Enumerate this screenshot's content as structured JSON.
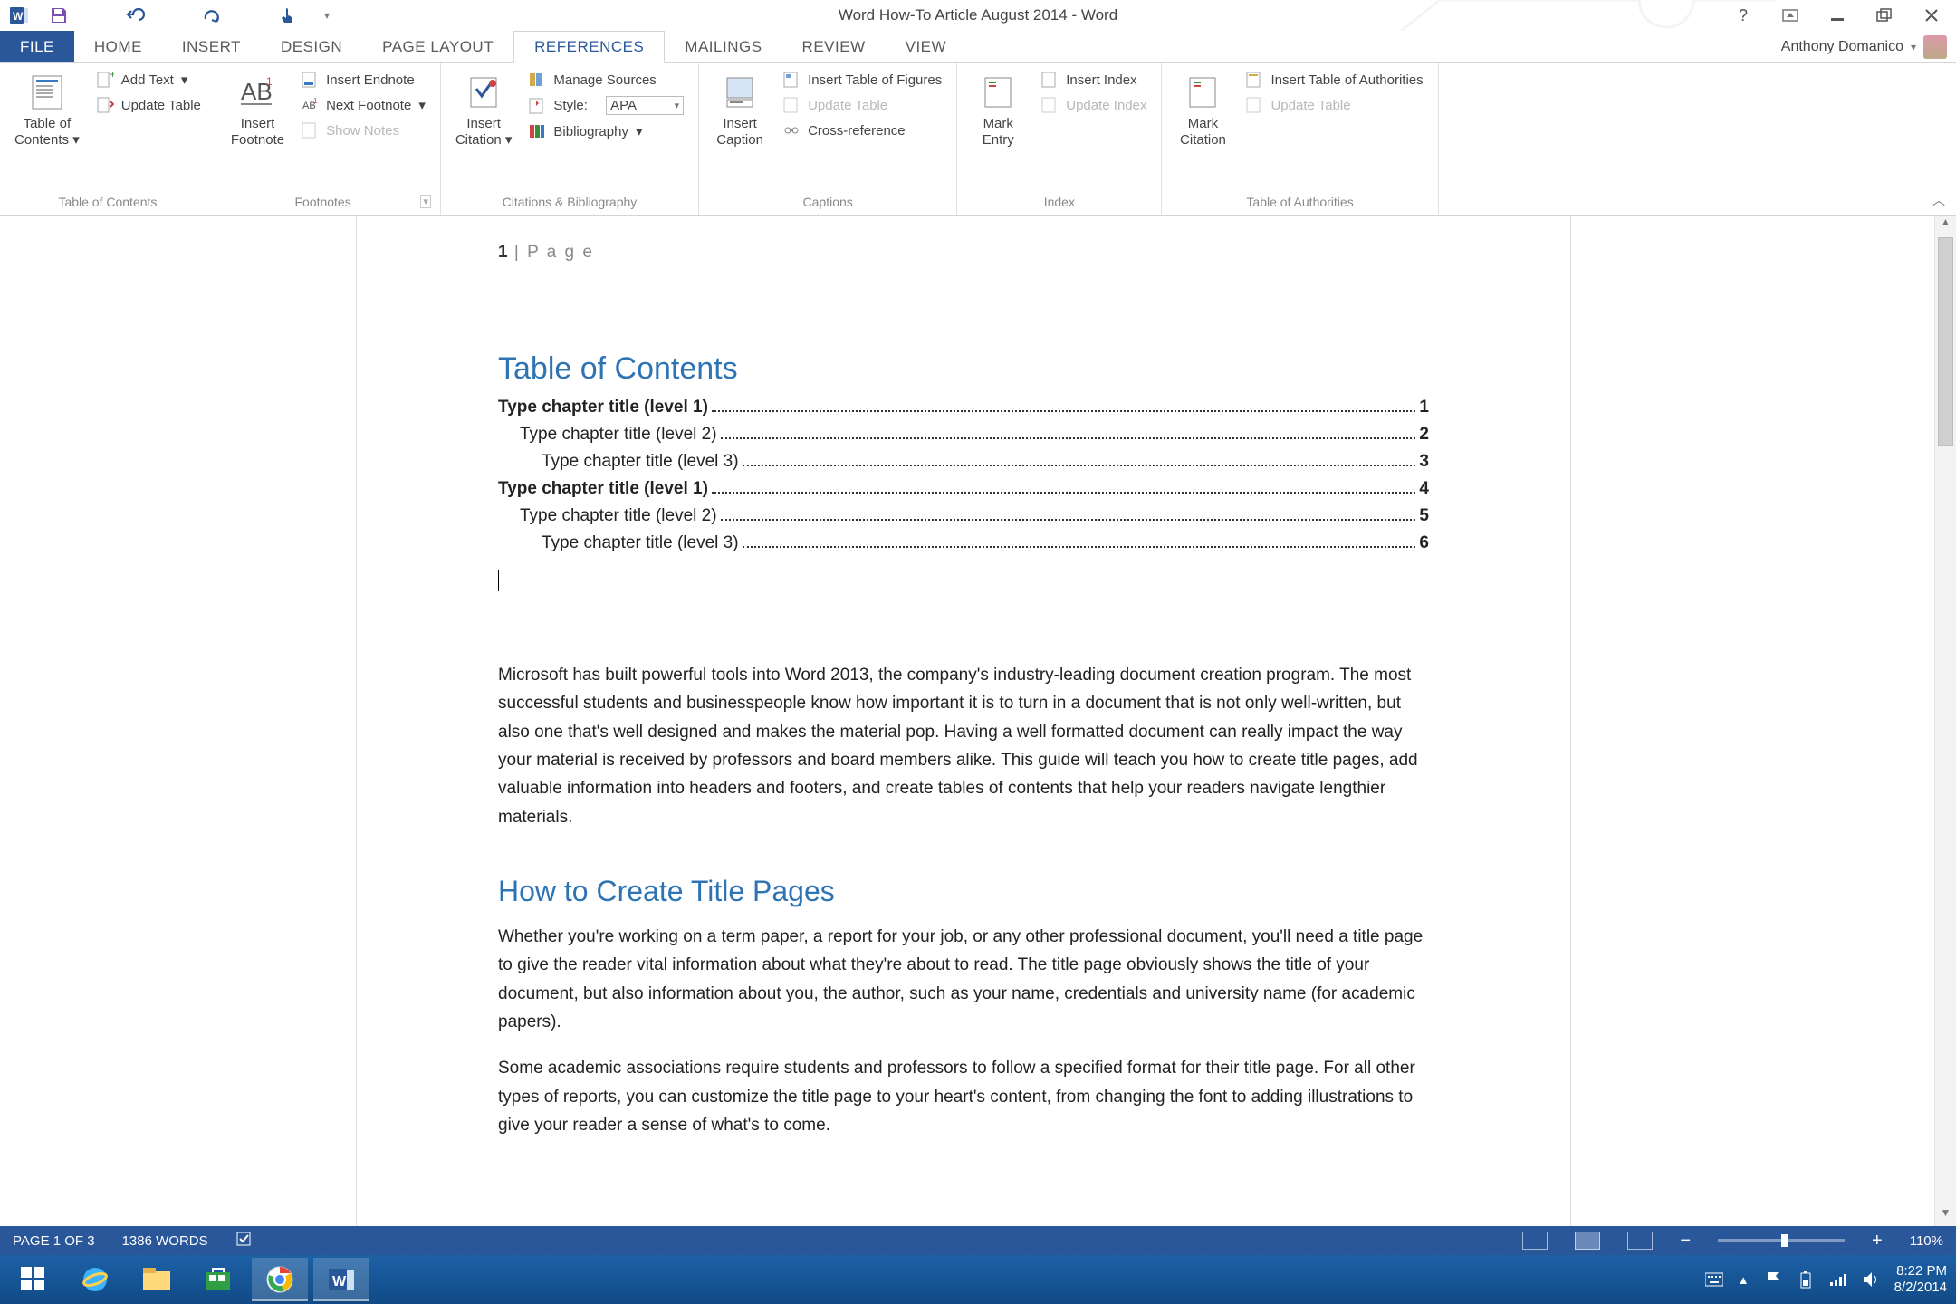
{
  "title": "Word How-To Article August 2014 - Word",
  "user": "Anthony Domanico",
  "tabs": [
    "FILE",
    "HOME",
    "INSERT",
    "DESIGN",
    "PAGE LAYOUT",
    "REFERENCES",
    "MAILINGS",
    "REVIEW",
    "VIEW"
  ],
  "active_tab": "REFERENCES",
  "ribbon": {
    "groups": [
      {
        "label": "Table of Contents",
        "big": {
          "line1": "Table of",
          "line2": "Contents"
        },
        "items": [
          "Add Text",
          "Update Table"
        ]
      },
      {
        "label": "Footnotes",
        "big": {
          "line1": "Insert",
          "line2": "Footnote"
        },
        "items": [
          "Insert Endnote",
          "Next Footnote",
          "Show Notes"
        ]
      },
      {
        "label": "Citations & Bibliography",
        "big": {
          "line1": "Insert",
          "line2": "Citation"
        },
        "items": [
          "Manage Sources",
          "Style:",
          "Bibliography"
        ],
        "style_value": "APA"
      },
      {
        "label": "Captions",
        "big": {
          "line1": "Insert",
          "line2": "Caption"
        },
        "items": [
          "Insert Table of Figures",
          "Update Table",
          "Cross-reference"
        ]
      },
      {
        "label": "Index",
        "big": {
          "line1": "Mark",
          "line2": "Entry"
        },
        "items": [
          "Insert Index",
          "Update Index"
        ]
      },
      {
        "label": "Table of Authorities",
        "big": {
          "line1": "Mark",
          "line2": "Citation"
        },
        "items": [
          "Insert Table of Authorities",
          "Update Table"
        ]
      }
    ]
  },
  "doc": {
    "page_header_num": "1",
    "page_header_text": "P a g e",
    "h_toc": "Table of Contents",
    "toc": [
      {
        "lvl": 1,
        "t": "Type chapter title (level 1)",
        "p": "1"
      },
      {
        "lvl": 2,
        "t": "Type chapter title (level 2)",
        "p": "2"
      },
      {
        "lvl": 3,
        "t": "Type chapter title (level 3)",
        "p": "3"
      },
      {
        "lvl": 1,
        "t": "Type chapter title (level 1)",
        "p": "4"
      },
      {
        "lvl": 2,
        "t": "Type chapter title (level 2)",
        "p": "5"
      },
      {
        "lvl": 3,
        "t": "Type chapter title (level 3)",
        "p": "6"
      }
    ],
    "para1": "Microsoft has built powerful tools into Word 2013, the company's industry-leading document creation program. The most successful students and businesspeople know how important it is to turn in a document that is not only well-written, but also one that's well designed and makes the material pop. Having a well formatted document can really impact the way your material is received by professors and board members alike. This guide will teach you how to create title pages, add valuable information into headers and footers, and create tables of contents that help your readers navigate lengthier materials.",
    "h_title": "How to Create Title Pages",
    "para2": "Whether you're working on a term paper, a report for your job, or any other professional document, you'll need a title page to give the reader vital information about what they're about to read. The title page obviously shows the title of your document, but also information about you, the author, such as your name, credentials and university name (for academic papers).",
    "para3": "Some academic associations require students and professors to follow a specified format for their title page. For all other types of reports, you can customize the title page to your heart's content, from changing the font to adding illustrations to give your reader a sense of what's to come."
  },
  "status": {
    "page": "PAGE 1 OF 3",
    "words": "1386 WORDS",
    "zoom": "110%"
  },
  "clock": {
    "time": "8:22 PM",
    "date": "8/2/2014"
  }
}
